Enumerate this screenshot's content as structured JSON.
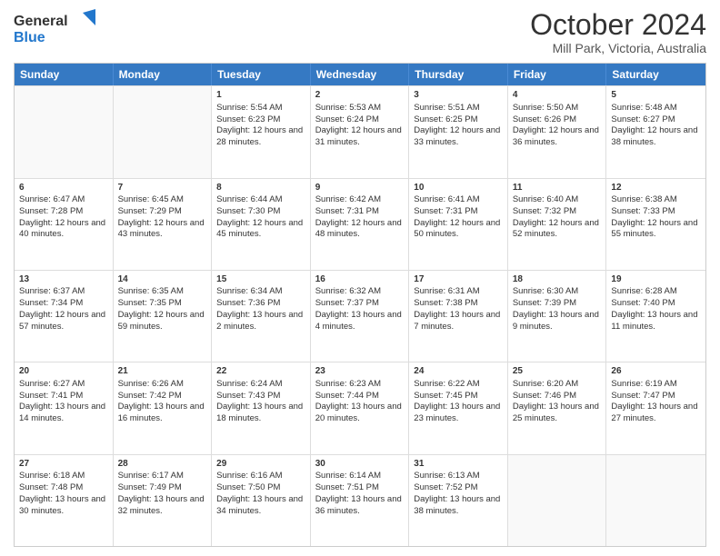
{
  "logo": {
    "general": "General",
    "blue": "Blue"
  },
  "title": "October 2024",
  "subtitle": "Mill Park, Victoria, Australia",
  "days": [
    "Sunday",
    "Monday",
    "Tuesday",
    "Wednesday",
    "Thursday",
    "Friday",
    "Saturday"
  ],
  "weeks": [
    [
      {
        "day": "",
        "empty": true
      },
      {
        "day": "",
        "empty": true
      },
      {
        "day": "1",
        "sunrise": "Sunrise: 5:54 AM",
        "sunset": "Sunset: 6:23 PM",
        "daylight": "Daylight: 12 hours and 28 minutes."
      },
      {
        "day": "2",
        "sunrise": "Sunrise: 5:53 AM",
        "sunset": "Sunset: 6:24 PM",
        "daylight": "Daylight: 12 hours and 31 minutes."
      },
      {
        "day": "3",
        "sunrise": "Sunrise: 5:51 AM",
        "sunset": "Sunset: 6:25 PM",
        "daylight": "Daylight: 12 hours and 33 minutes."
      },
      {
        "day": "4",
        "sunrise": "Sunrise: 5:50 AM",
        "sunset": "Sunset: 6:26 PM",
        "daylight": "Daylight: 12 hours and 36 minutes."
      },
      {
        "day": "5",
        "sunrise": "Sunrise: 5:48 AM",
        "sunset": "Sunset: 6:27 PM",
        "daylight": "Daylight: 12 hours and 38 minutes."
      }
    ],
    [
      {
        "day": "6",
        "sunrise": "Sunrise: 6:47 AM",
        "sunset": "Sunset: 7:28 PM",
        "daylight": "Daylight: 12 hours and 40 minutes."
      },
      {
        "day": "7",
        "sunrise": "Sunrise: 6:45 AM",
        "sunset": "Sunset: 7:29 PM",
        "daylight": "Daylight: 12 hours and 43 minutes."
      },
      {
        "day": "8",
        "sunrise": "Sunrise: 6:44 AM",
        "sunset": "Sunset: 7:30 PM",
        "daylight": "Daylight: 12 hours and 45 minutes."
      },
      {
        "day": "9",
        "sunrise": "Sunrise: 6:42 AM",
        "sunset": "Sunset: 7:31 PM",
        "daylight": "Daylight: 12 hours and 48 minutes."
      },
      {
        "day": "10",
        "sunrise": "Sunrise: 6:41 AM",
        "sunset": "Sunset: 7:31 PM",
        "daylight": "Daylight: 12 hours and 50 minutes."
      },
      {
        "day": "11",
        "sunrise": "Sunrise: 6:40 AM",
        "sunset": "Sunset: 7:32 PM",
        "daylight": "Daylight: 12 hours and 52 minutes."
      },
      {
        "day": "12",
        "sunrise": "Sunrise: 6:38 AM",
        "sunset": "Sunset: 7:33 PM",
        "daylight": "Daylight: 12 hours and 55 minutes."
      }
    ],
    [
      {
        "day": "13",
        "sunrise": "Sunrise: 6:37 AM",
        "sunset": "Sunset: 7:34 PM",
        "daylight": "Daylight: 12 hours and 57 minutes."
      },
      {
        "day": "14",
        "sunrise": "Sunrise: 6:35 AM",
        "sunset": "Sunset: 7:35 PM",
        "daylight": "Daylight: 12 hours and 59 minutes."
      },
      {
        "day": "15",
        "sunrise": "Sunrise: 6:34 AM",
        "sunset": "Sunset: 7:36 PM",
        "daylight": "Daylight: 13 hours and 2 minutes."
      },
      {
        "day": "16",
        "sunrise": "Sunrise: 6:32 AM",
        "sunset": "Sunset: 7:37 PM",
        "daylight": "Daylight: 13 hours and 4 minutes."
      },
      {
        "day": "17",
        "sunrise": "Sunrise: 6:31 AM",
        "sunset": "Sunset: 7:38 PM",
        "daylight": "Daylight: 13 hours and 7 minutes."
      },
      {
        "day": "18",
        "sunrise": "Sunrise: 6:30 AM",
        "sunset": "Sunset: 7:39 PM",
        "daylight": "Daylight: 13 hours and 9 minutes."
      },
      {
        "day": "19",
        "sunrise": "Sunrise: 6:28 AM",
        "sunset": "Sunset: 7:40 PM",
        "daylight": "Daylight: 13 hours and 11 minutes."
      }
    ],
    [
      {
        "day": "20",
        "sunrise": "Sunrise: 6:27 AM",
        "sunset": "Sunset: 7:41 PM",
        "daylight": "Daylight: 13 hours and 14 minutes."
      },
      {
        "day": "21",
        "sunrise": "Sunrise: 6:26 AM",
        "sunset": "Sunset: 7:42 PM",
        "daylight": "Daylight: 13 hours and 16 minutes."
      },
      {
        "day": "22",
        "sunrise": "Sunrise: 6:24 AM",
        "sunset": "Sunset: 7:43 PM",
        "daylight": "Daylight: 13 hours and 18 minutes."
      },
      {
        "day": "23",
        "sunrise": "Sunrise: 6:23 AM",
        "sunset": "Sunset: 7:44 PM",
        "daylight": "Daylight: 13 hours and 20 minutes."
      },
      {
        "day": "24",
        "sunrise": "Sunrise: 6:22 AM",
        "sunset": "Sunset: 7:45 PM",
        "daylight": "Daylight: 13 hours and 23 minutes."
      },
      {
        "day": "25",
        "sunrise": "Sunrise: 6:20 AM",
        "sunset": "Sunset: 7:46 PM",
        "daylight": "Daylight: 13 hours and 25 minutes."
      },
      {
        "day": "26",
        "sunrise": "Sunrise: 6:19 AM",
        "sunset": "Sunset: 7:47 PM",
        "daylight": "Daylight: 13 hours and 27 minutes."
      }
    ],
    [
      {
        "day": "27",
        "sunrise": "Sunrise: 6:18 AM",
        "sunset": "Sunset: 7:48 PM",
        "daylight": "Daylight: 13 hours and 30 minutes."
      },
      {
        "day": "28",
        "sunrise": "Sunrise: 6:17 AM",
        "sunset": "Sunset: 7:49 PM",
        "daylight": "Daylight: 13 hours and 32 minutes."
      },
      {
        "day": "29",
        "sunrise": "Sunrise: 6:16 AM",
        "sunset": "Sunset: 7:50 PM",
        "daylight": "Daylight: 13 hours and 34 minutes."
      },
      {
        "day": "30",
        "sunrise": "Sunrise: 6:14 AM",
        "sunset": "Sunset: 7:51 PM",
        "daylight": "Daylight: 13 hours and 36 minutes."
      },
      {
        "day": "31",
        "sunrise": "Sunrise: 6:13 AM",
        "sunset": "Sunset: 7:52 PM",
        "daylight": "Daylight: 13 hours and 38 minutes."
      },
      {
        "day": "",
        "empty": true
      },
      {
        "day": "",
        "empty": true
      }
    ]
  ]
}
